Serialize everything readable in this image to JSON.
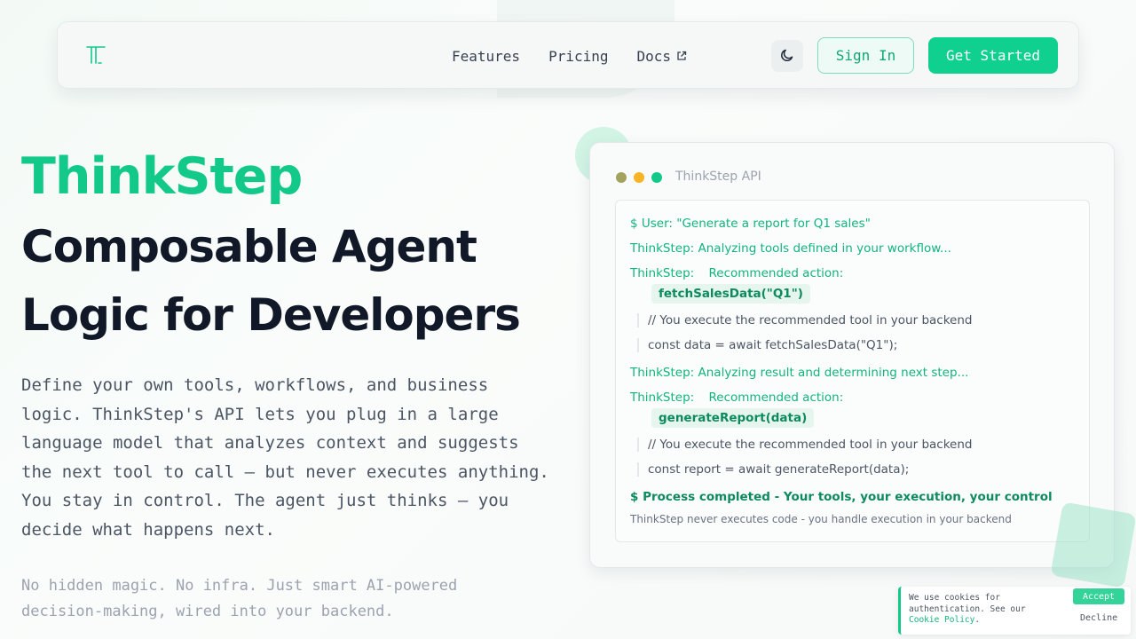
{
  "colors": {
    "brand": "#12c98a",
    "accent_button": "#10d08f",
    "text_dark": "#111827",
    "dot_red": "#a3a35f",
    "dot_yellow": "#f5b325",
    "dot_green": "#12c98a"
  },
  "nav": {
    "logo_icon": "t-logo-icon",
    "links": [
      {
        "label": "Features"
      },
      {
        "label": "Pricing"
      },
      {
        "label": "Docs",
        "icon": "external-link-icon"
      }
    ],
    "theme_icon": "moon-icon",
    "signin_label": "Sign In",
    "getstarted_label": "Get Started"
  },
  "hero": {
    "brand": "ThinkStep",
    "headline": "Composable Agent Logic for Developers",
    "description": "Define your own tools, workflows, and business logic. ThinkStep's API lets you plug in a large language model that analyzes context and suggests the next tool to call — but never executes anything. You stay in control. The agent just thinks — you decide what happens next.",
    "note": "No hidden magic. No infra. Just smart AI-powered decision-making, wired into your backend."
  },
  "terminal": {
    "title": "ThinkStep API",
    "lines": {
      "user": "$ User: \"Generate a report for Q1 sales\"",
      "analyzing1": "ThinkStep: Analyzing tools defined in your workflow...",
      "rec1_prefix": "ThinkStep:",
      "rec1_label": "Recommended action:",
      "rec1_chip": "fetchSalesData(\"Q1\")",
      "comment1": "// You execute the recommended tool in your backend",
      "code1": "const data = await fetchSalesData(\"Q1\");",
      "analyzing2": "ThinkStep: Analyzing result and determining next step...",
      "rec2_prefix": "ThinkStep:",
      "rec2_label": "Recommended action:",
      "rec2_chip": "generateReport(data)",
      "comment2": "// You execute the recommended tool in your backend",
      "code2": "const report = await generateReport(data);",
      "completed": "$ Process completed - Your tools, your execution, your control",
      "footnote": "ThinkStep never executes code - you handle execution in your backend"
    }
  },
  "cookie": {
    "text": "We use cookies for authentication. See our",
    "link": "Cookie Policy",
    "link_suffix": ".",
    "accept_label": "Accept",
    "decline_label": "Decline"
  }
}
